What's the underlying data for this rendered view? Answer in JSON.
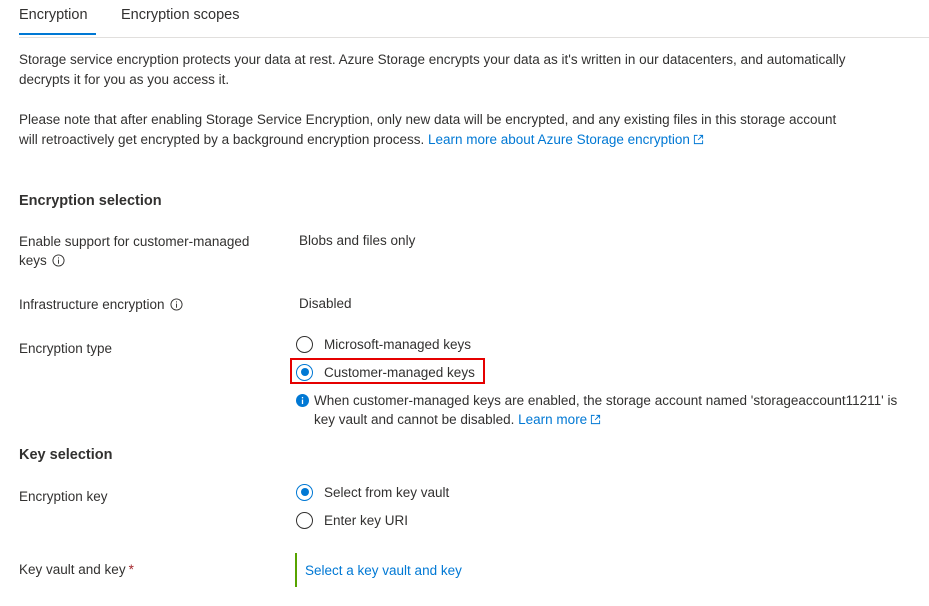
{
  "tabs": [
    {
      "label": "Encryption",
      "active": true
    },
    {
      "label": "Encryption scopes",
      "active": false
    }
  ],
  "intro": {
    "line1": "Storage service encryption protects your data at rest. Azure Storage encrypts your data as it's written in our datacenters, and automatically",
    "line2": "decrypts it for you as you access it."
  },
  "note_para": {
    "line1": "Please note that after enabling Storage Service Encryption, only new data will be encrypted, and any existing files in this storage account",
    "line2": "will retroactively get encrypted by a background encryption process.",
    "link": "Learn more about Azure Storage encryption"
  },
  "encryption_selection": {
    "title": "Encryption selection",
    "cmk_support": {
      "label_line1": "Enable support for customer-managed",
      "label_line2": "keys",
      "value": "Blobs and files only"
    },
    "infrastructure": {
      "label": "Infrastructure encryption",
      "value": "Disabled"
    },
    "encryption_type": {
      "label": "Encryption type",
      "options": [
        {
          "label": "Microsoft-managed keys",
          "selected": false
        },
        {
          "label": "Customer-managed keys",
          "selected": true
        }
      ],
      "info_line1": "When customer-managed keys are enabled, the storage account named 'storageaccount11211' is",
      "info_line2": "key vault and cannot be disabled.",
      "info_link": "Learn more"
    }
  },
  "key_selection": {
    "title": "Key selection",
    "encryption_key": {
      "label": "Encryption key",
      "options": [
        {
          "label": "Select from key vault",
          "selected": true
        },
        {
          "label": "Enter key URI",
          "selected": false
        }
      ]
    },
    "key_vault": {
      "label": "Key vault and key",
      "required_mark": "*",
      "link": "Select a key vault and key"
    }
  },
  "colors": {
    "accent": "#0078d4",
    "highlight": "#e50000",
    "valid_bar": "#57a300",
    "required": "#a4262c"
  }
}
